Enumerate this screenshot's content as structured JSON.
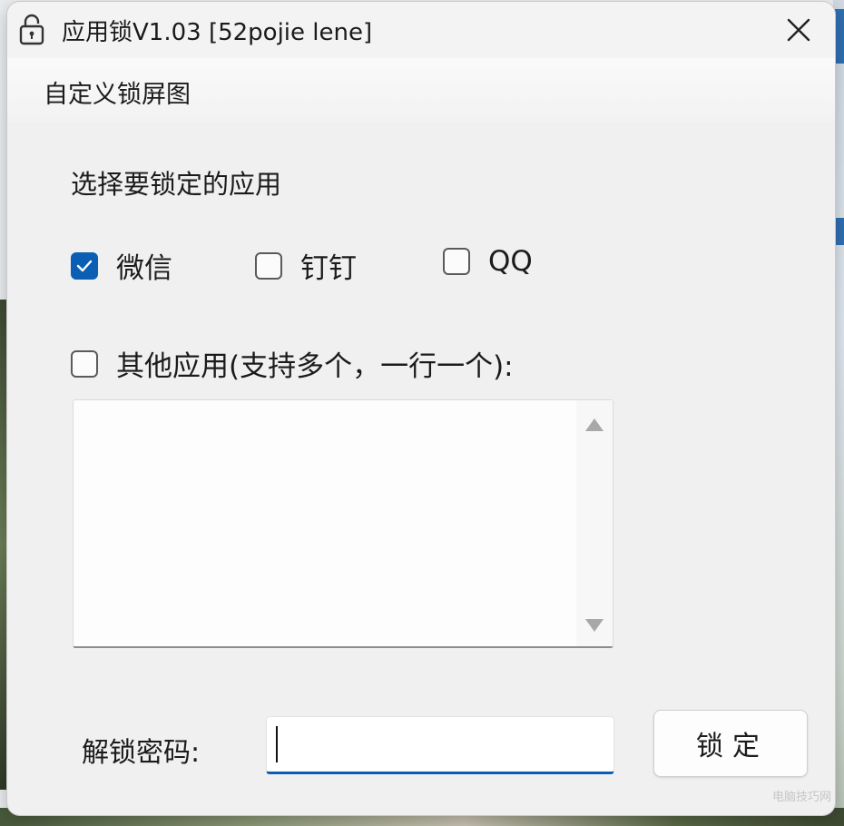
{
  "window": {
    "title": "应用锁V1.03 [52pojie lene]",
    "icon": "padlock-icon",
    "close_icon": "close-icon"
  },
  "menu": {
    "items": [
      {
        "label": "自定义锁屏图"
      }
    ]
  },
  "apps_section": {
    "label": "选择要锁定的应用",
    "options": [
      {
        "label": "微信",
        "checked": true
      },
      {
        "label": "钉钉",
        "checked": false
      },
      {
        "label": "QQ",
        "checked": false
      }
    ],
    "other": {
      "label": "其他应用(支持多个，一行一个):",
      "checked": false,
      "value": ""
    }
  },
  "password": {
    "label": "解锁密码:",
    "value": ""
  },
  "lock_button": {
    "label": "锁定"
  },
  "watermark": "电脑技巧网",
  "colors": {
    "accent": "#0a5fb4",
    "window_bg": "#f0f0f0"
  }
}
